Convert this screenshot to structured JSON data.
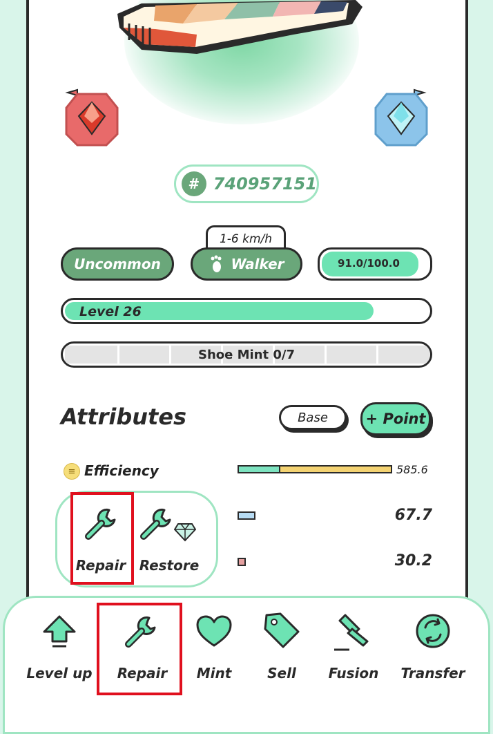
{
  "token": {
    "hash_symbol": "#",
    "id": "740957151"
  },
  "badges": {
    "rarity": "Uncommon",
    "type": "Walker",
    "speed": "1-6 km/h",
    "durability": "91.0/100.0",
    "durability_fraction": 0.91
  },
  "level": {
    "label": "Level 26",
    "progress": 0.85
  },
  "shoe_mint": {
    "label": "Shoe Mint 0/7",
    "count": 0,
    "max": 7
  },
  "attributes": {
    "title": "Attributes",
    "base_button": "Base",
    "point_button": "+ Point",
    "rows": [
      {
        "name": "Efficiency",
        "value": "585.6"
      },
      {
        "name": "",
        "value": "67.7"
      },
      {
        "name": "",
        "value": "30.2"
      }
    ]
  },
  "popup": {
    "repair_label": "Repair",
    "restore_label": "Restore"
  },
  "nav": {
    "items": [
      {
        "label": "Level up",
        "icon": "arrow-up-icon"
      },
      {
        "label": "Repair",
        "icon": "wrench-icon"
      },
      {
        "label": "Mint",
        "icon": "heart-icon"
      },
      {
        "label": "Sell",
        "icon": "tag-icon"
      },
      {
        "label": "Fusion",
        "icon": "hammer-icon"
      },
      {
        "label": "Transfer",
        "icon": "swap-icon"
      }
    ]
  },
  "colors": {
    "accent": "#6de3b3",
    "green_pill": "#6aa77a",
    "gem_red": "#e86a6a",
    "gem_blue": "#8cc4ea",
    "highlight": "#e0101e"
  }
}
